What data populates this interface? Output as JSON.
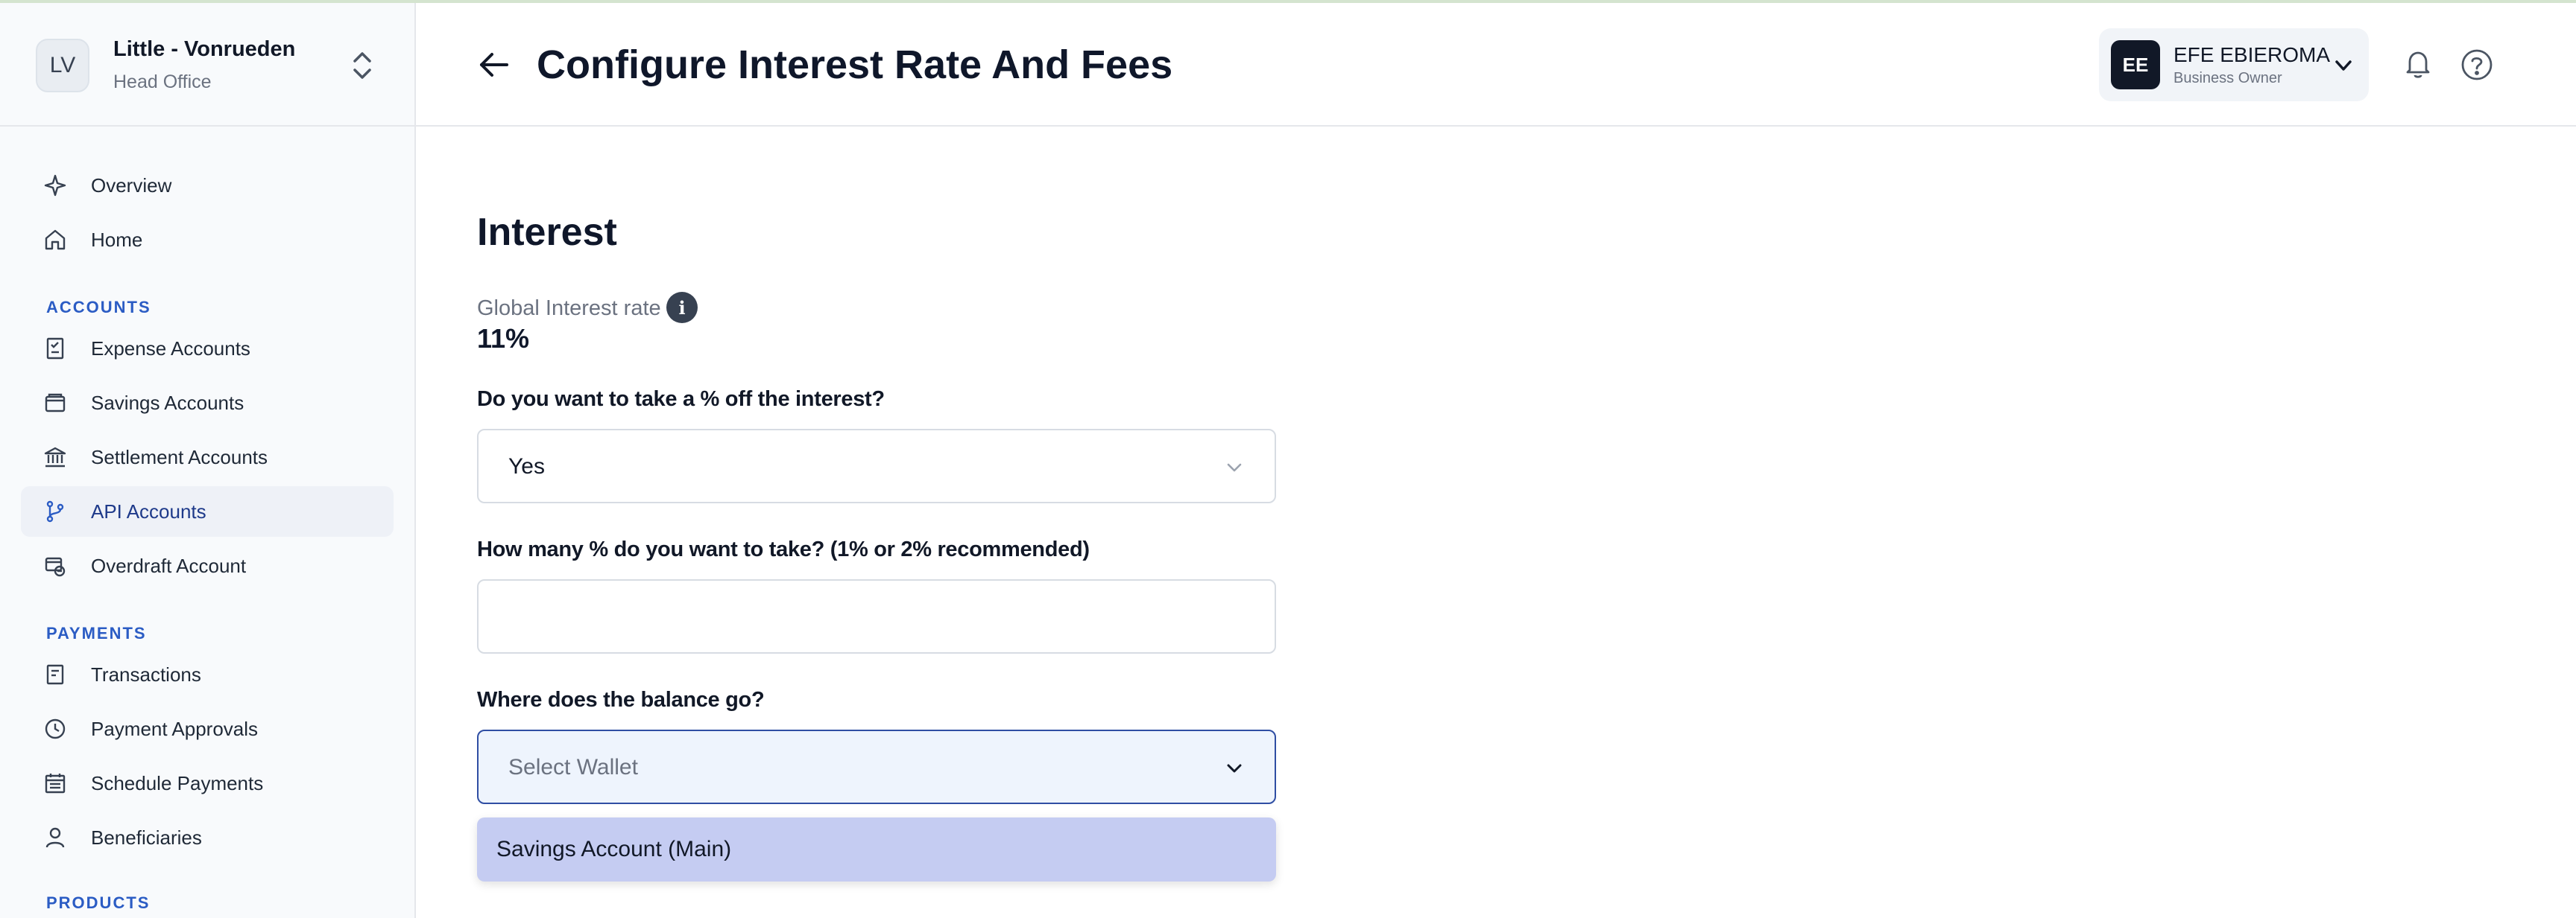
{
  "org": {
    "initials": "LV",
    "name": "Little - Vonrueden",
    "subtitle": "Head Office"
  },
  "nav": {
    "top": [
      {
        "label": "Overview",
        "icon": "sparkle-icon"
      },
      {
        "label": "Home",
        "icon": "home-icon"
      }
    ],
    "accounts_heading": "ACCOUNTS",
    "accounts": [
      {
        "label": "Expense Accounts",
        "icon": "receipt-icon"
      },
      {
        "label": "Savings Accounts",
        "icon": "wallet-icon"
      },
      {
        "label": "Settlement Accounts",
        "icon": "bank-icon"
      },
      {
        "label": "API Accounts",
        "icon": "git-branch-icon",
        "active": true
      },
      {
        "label": "Overdraft Account",
        "icon": "overdraft-icon"
      }
    ],
    "payments_heading": "PAYMENTS",
    "payments": [
      {
        "label": "Transactions",
        "icon": "document-icon"
      },
      {
        "label": "Payment Approvals",
        "icon": "clock-icon"
      },
      {
        "label": "Schedule Payments",
        "icon": "calendar-icon"
      },
      {
        "label": "Beneficiaries",
        "icon": "user-icon"
      }
    ],
    "products_heading": "PRODUCTS"
  },
  "header": {
    "title": "Configure Interest Rate And Fees",
    "user": {
      "initials": "EE",
      "name": "EFE EBIEROMA",
      "role": "Business Owner"
    }
  },
  "main": {
    "heading": "Interest",
    "global_rate_label": "Global Interest rate",
    "global_rate_value": "11%",
    "q1": {
      "label": "Do you want to take a % off the interest?",
      "value": "Yes"
    },
    "q2": {
      "label": "How many % do you want to take? (1% or 2% recommended)",
      "value": ""
    },
    "q3": {
      "label": "Where does the balance go?",
      "placeholder": "Select Wallet"
    },
    "dropdown_options": [
      "Savings Account (Main)"
    ]
  },
  "colors": {
    "accent": "#2b5cc4",
    "active_bg": "#eef1f7",
    "option_bg": "#c5ccf2"
  }
}
